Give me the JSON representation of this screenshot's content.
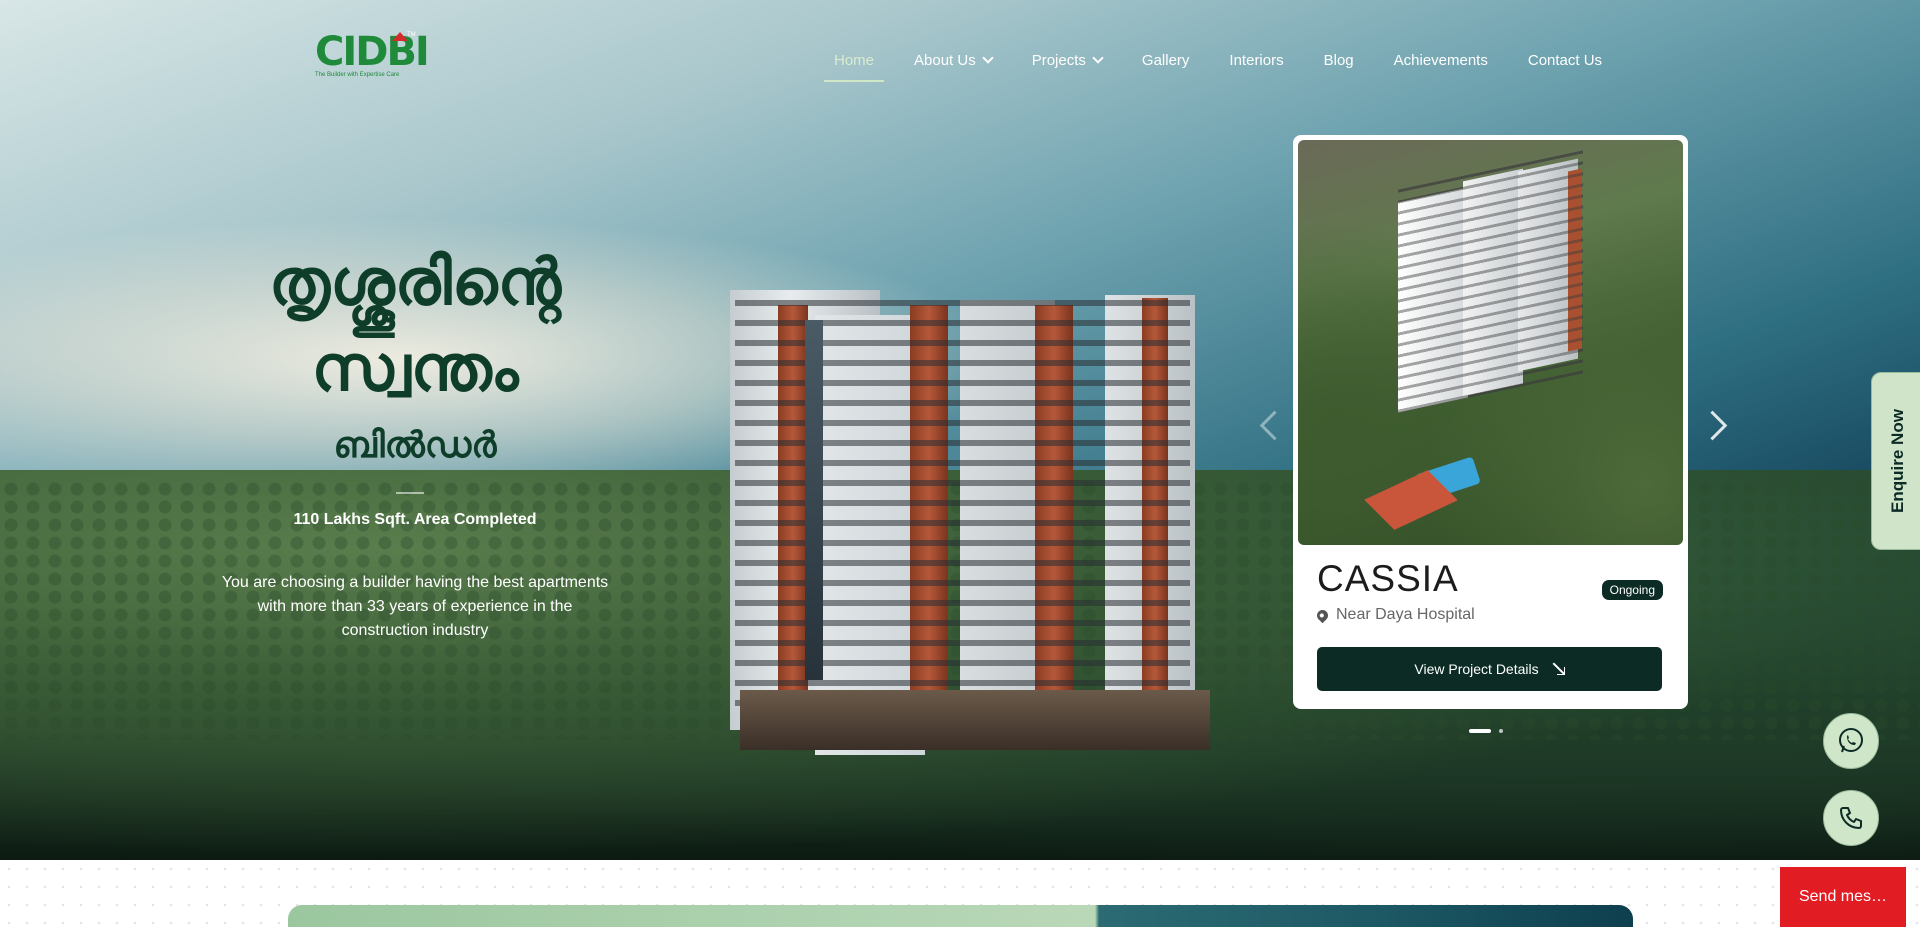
{
  "header": {
    "logo": {
      "mark": "CIDBI",
      "tagline": "The Builder with Expertise Care",
      "tm": "TM"
    },
    "nav": [
      {
        "label": "Home",
        "active": true
      },
      {
        "label": "About Us",
        "dropdown": true
      },
      {
        "label": "Projects",
        "dropdown": true
      },
      {
        "label": "Gallery"
      },
      {
        "label": "Interiors"
      },
      {
        "label": "Blog"
      },
      {
        "label": "Achievements"
      },
      {
        "label": "Contact Us"
      }
    ]
  },
  "hero": {
    "title_line1": "തൃശ്ശൂരിന്റെ",
    "title_line2": "സ്വന്തം",
    "title_line3": "ബിൽഡർ",
    "stat": "110 Lakhs Sqft. Area Completed",
    "description": "You are choosing a builder having the best apartments with more than 33 years of experience in the construction industry"
  },
  "project_card": {
    "name": "CASSIA",
    "status": "Ongoing",
    "location": "Near Daya Hospital",
    "button_label": "View Project Details",
    "slides_total": 2,
    "active_slide": 1
  },
  "side": {
    "enquire_label": "Enquire Now",
    "whatsapp_icon": "whatsapp-icon",
    "phone_icon": "phone-icon"
  },
  "chat": {
    "send_label": "Send mes…"
  },
  "colors": {
    "brand_green": "#1e8a3a",
    "dark_green": "#0c2b24",
    "accent_red": "#e21c23",
    "pale_green": "#cfe6c9"
  }
}
